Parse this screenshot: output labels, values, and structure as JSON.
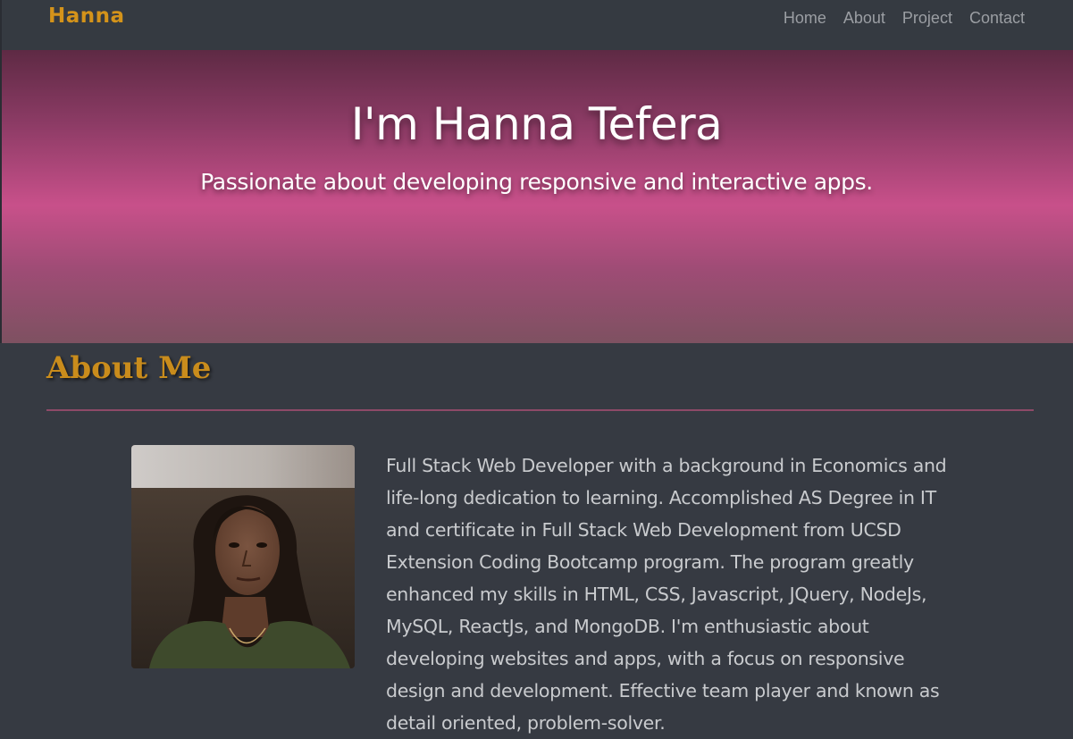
{
  "brand": "Hanna",
  "nav": {
    "items": [
      "Home",
      "About",
      "Project",
      "Contact"
    ]
  },
  "hero": {
    "title": "I'm Hanna Tefera",
    "subtitle": "Passionate about developing responsive and interactive apps."
  },
  "about": {
    "heading": "About Me",
    "photo_alt": "Profile photo of Hanna Tefera",
    "text": "Full Stack Web Developer with a background in Economics and life-long dedication to learning. Accomplished AS Degree in IT and certificate in Full Stack Web Development from UCSD Extension Coding Bootcamp program. The program greatly enhanced my skills in HTML, CSS, Javascript, JQuery, NodeJs, MySQL, ReactJs, and MongoDB. I'm enthusiastic about developing websites and apps, with a focus on responsive design and development. Effective team player and known as detail oriented, problem-solver."
  },
  "colors": {
    "brand": "#d4931a",
    "heading": "#c98c1c",
    "page_background": "#363a42",
    "hero_pink": "#c8508a",
    "divider": "#8e4968"
  }
}
